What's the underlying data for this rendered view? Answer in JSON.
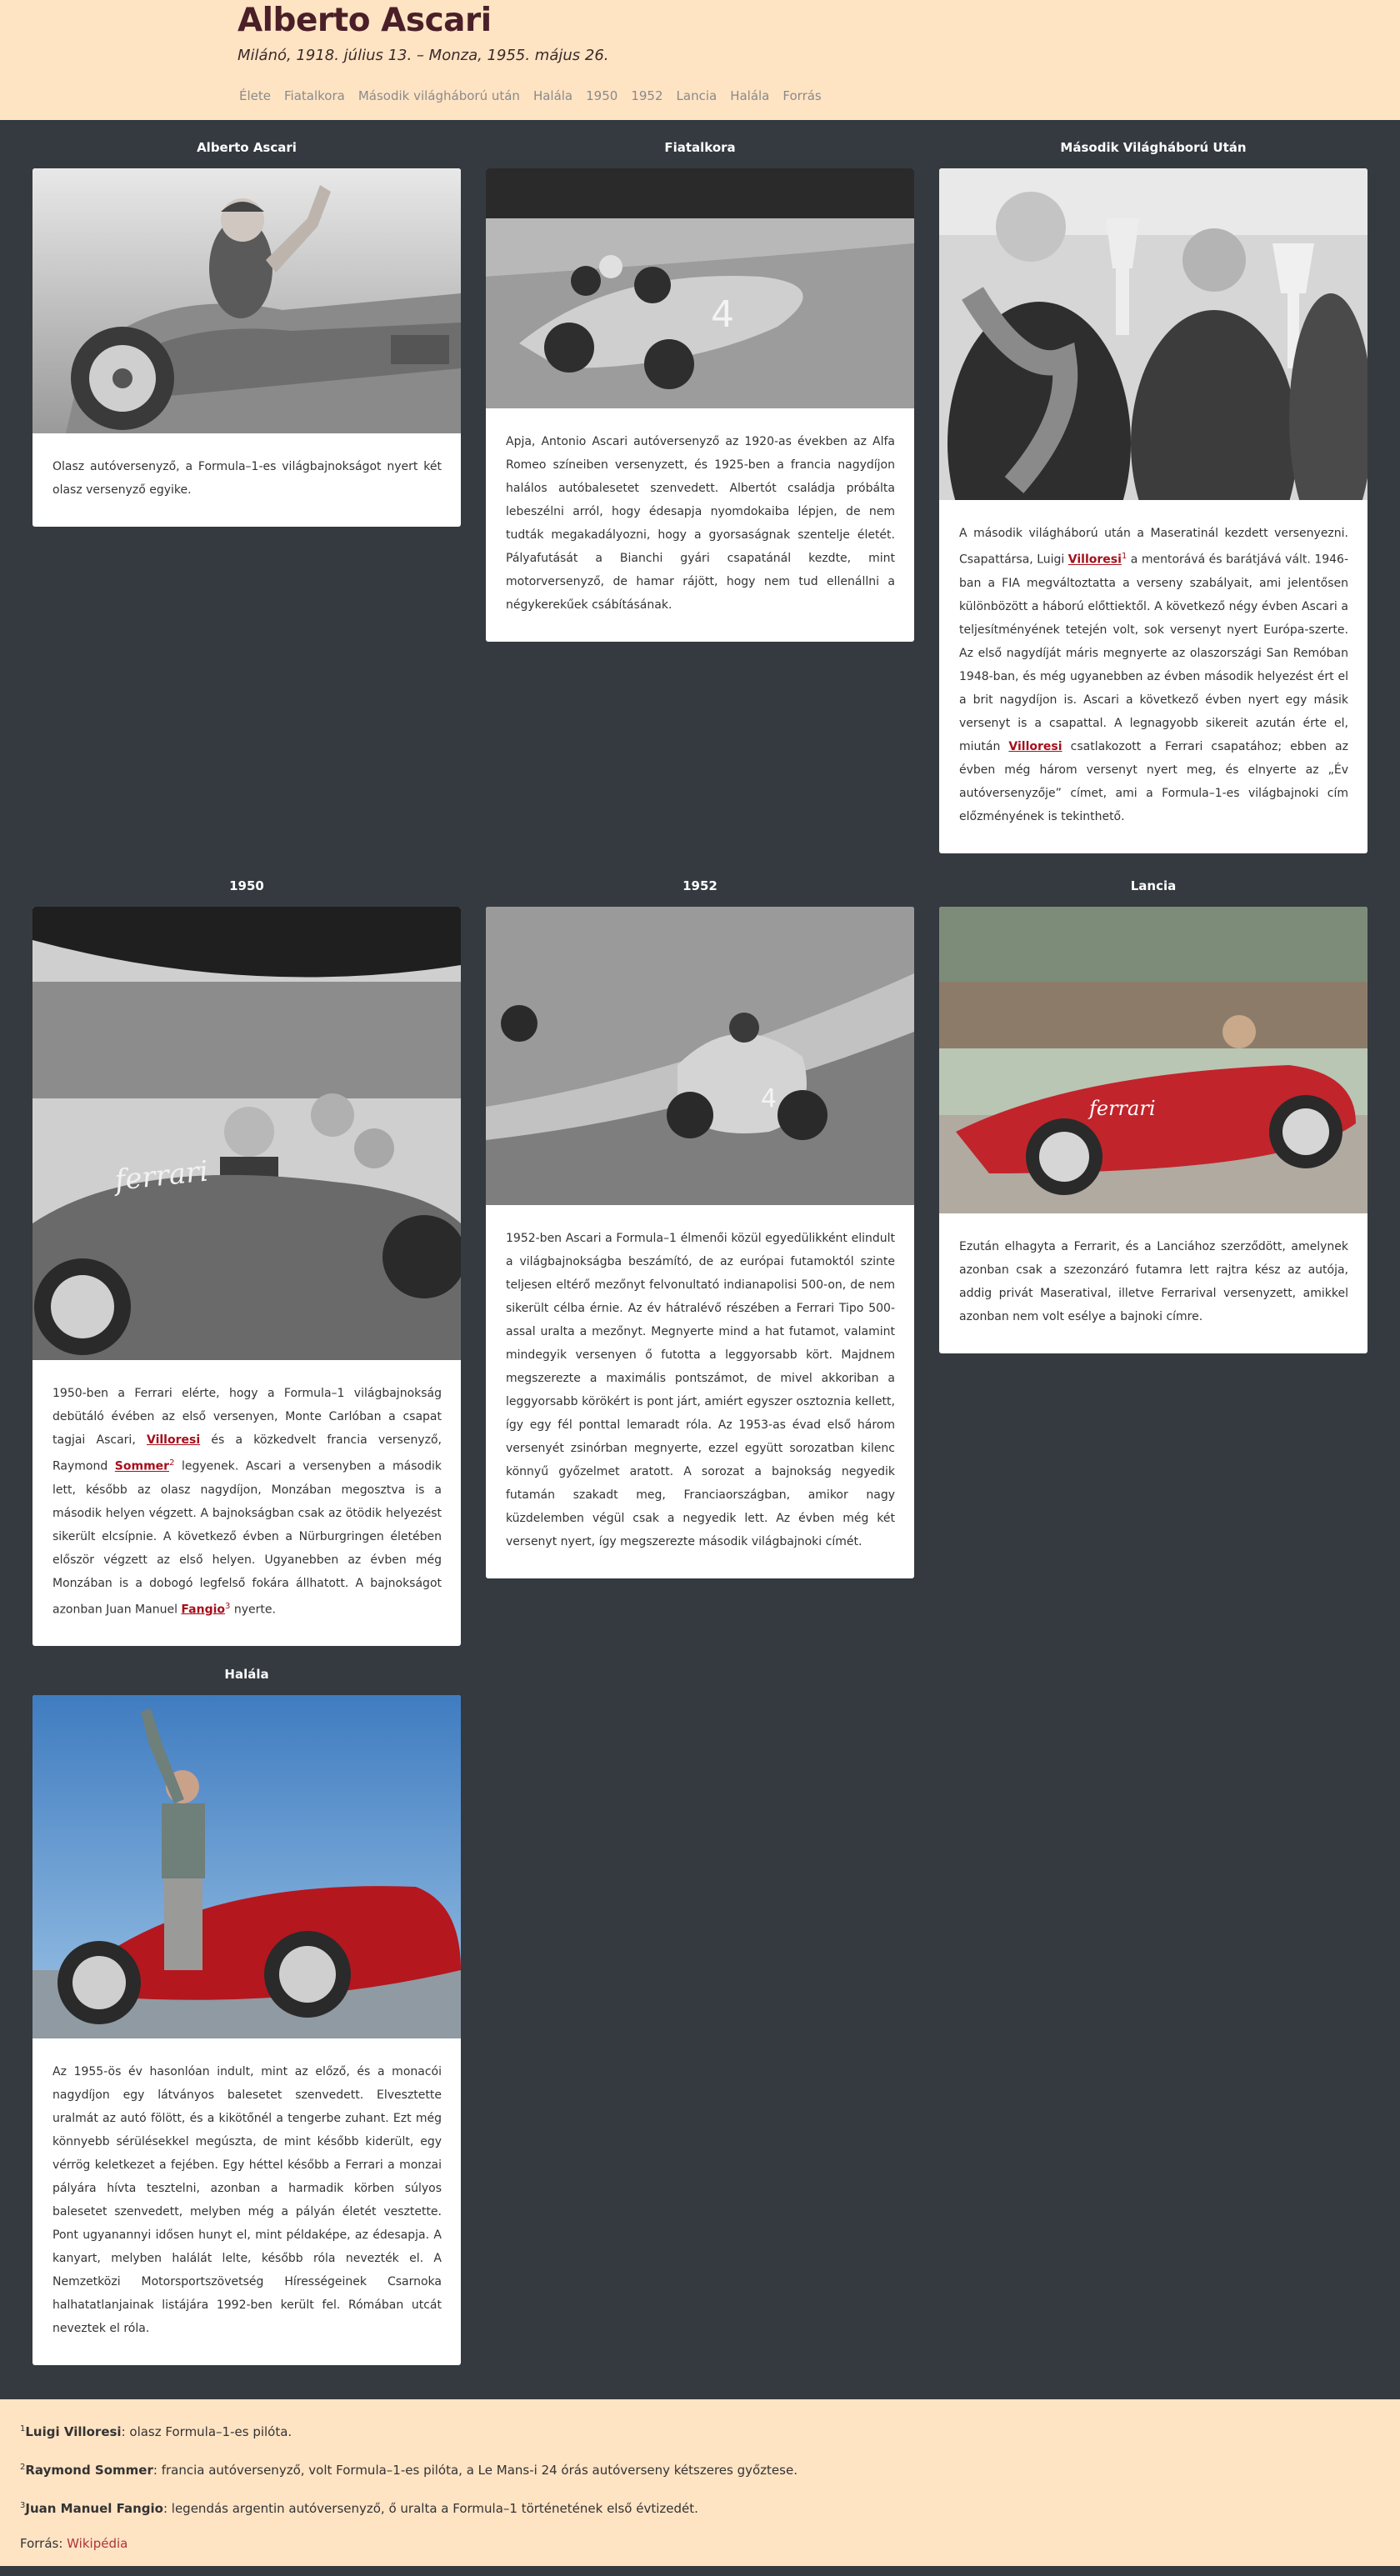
{
  "header": {
    "title": "Alberto Ascari",
    "subtitle": "Milánó, 1918. július 13. – Monza, 1955. május 26.",
    "nav": [
      "Élete",
      "Fiatalkora",
      "Második világháború után",
      "Halála",
      "1950",
      "1952",
      "Lancia",
      "Halála",
      "Forrás"
    ]
  },
  "sections": [
    {
      "title": "Alberto Ascari",
      "text": "Olasz autóversenyző, a Formula–1-es világbajnokságot nyert két olasz versenyző egyike."
    },
    {
      "title": "Fiatalkora",
      "text": "Apja, Antonio Ascari autóversenyző az 1920-as években az Alfa Romeo színeiben versenyzett, és 1925-ben a francia nagydíjon halálos autóbalesetet szenvedett. Albertót családja próbálta lebeszélni arról, hogy édesapja nyomdokaiba lépjen, de nem tudták megakadályozni, hogy a gyorsaságnak szentelje életét. Pályafutását a Bianchi gyári csapatánál kezdte, mint motorversenyző, de hamar rájött, hogy nem tud ellenállni a négykerekűek csábításának."
    },
    {
      "title": "Második Világháború Után",
      "p1": "A második világháború után a Maseratinál kezdett versenyezni. Csapattársa, Luigi ",
      "link1": "Villoresi",
      "sup1": "1",
      "p2": " a mentorává és barátjává vált. 1946-ban a FIA megváltoztatta a verseny szabályait, ami jelentősen különbözött a háború előttiektől. A következő négy évben Ascari a teljesítményének tetején volt, sok versenyt nyert Európa-szerte. Az első nagydíját máris megnyerte az olaszországi San Remóban 1948-ban, és még ugyanebben az évben második helyezést ért el a brit nagydíjon is. Ascari a következő évben nyert egy másik versenyt is a csapattal. A legnagyobb sikereit azután érte el, miután ",
      "link2": "Villoresi",
      "p3": " csatlakozott a Ferrari csapatához; ebben az évben még három versenyt nyert meg, és elnyerte az „Év autóversenyzője” címet, ami a Formula–1-es világbajnoki cím előzményének is tekinthető."
    },
    {
      "title": "1950",
      "p1": "1950-ben a Ferrari elérte, hogy a Formula–1 világbajnokság debütáló évében az első versenyen, Monte Carlóban a csapat tagjai Ascari, ",
      "link1": "Villoresi",
      "p2": " és a közkedvelt francia versenyző, Raymond ",
      "link2": "Sommer",
      "sup2": "2",
      "p3": " legyenek. Ascari a versenyben a második lett, később az olasz nagydíjon, Monzában megosztva is a második helyen végzett. A bajnokságban csak az ötödik helyezést sikerült elcsípnie. A következő évben a Nürburgringen életében először végzett az első helyen. Ugyanebben az évben még Monzában is a dobogó legfelső fokára állhatott. A bajnokságot azonban Juan Manuel ",
      "link3": "Fangio",
      "sup3": "3",
      "p4": " nyerte."
    },
    {
      "title": "1952",
      "text": "1952-ben Ascari a Formula–1 élmenői közül egyedülikként elindult a világbajnokságba beszámító, de az európai futamoktól szinte teljesen eltérő mezőnyt felvonultató indianapolisi 500-on, de nem sikerült célba érnie. Az év hátralévő részében a Ferrari Tipo 500-assal uralta a mezőnyt. Megnyerte mind a hat futamot, valamint mindegyik versenyen ő futotta a leggyorsabb kört. Majdnem megszerezte a maximális pontszámot, de mivel akkoriban a leggyorsabb körökért is pont járt, amiért egyszer osztoznia kellett, így egy fél ponttal lemaradt róla. Az 1953-as évad első három versenyét zsinórban megnyerte, ezzel együtt sorozatban kilenc könnyű győzelmet aratott. A sorozat a bajnokság negyedik futamán szakadt meg, Franciaországban, amikor nagy küzdelemben végül csak a negyedik lett. Az évben még két versenyt nyert, így megszerezte második világbajnoki címét."
    },
    {
      "title": "Lancia",
      "text": "Ezután elhagyta a Ferrarit, és a Lanciához szerződött, amelynek azonban csak a szezonzáró futamra lett rajtra kész az autója, addig privát Maseratival, illetve Ferrarival versenyzett, amikkel azonban nem volt esélye a bajnoki címre."
    },
    {
      "title": "Halála",
      "text": "Az 1955-ös év hasonlóan indult, mint az előző, és a monacói nagydíjon egy látványos balesetet szenvedett. Elvesztette uralmát az autó fölött, és a kikötőnél a tengerbe zuhant. Ezt még könnyebb sérülésekkel megúszta, de mint később kiderült, egy vérrög keletkezet a fejében. Egy héttel később a Ferrari a monzai pályára hívta tesztelni, azonban a harmadik körben súlyos balesetet szenvedett, melyben még a pályán életét vesztette. Pont ugyanannyi idősen hunyt el, mint példaképe, az édesapja. A kanyart, melyben halálát lelte, később róla nevezték el. A Nemzetközi Motorsportszövetség Hírességeinek Csarnoka halhatatlanjainak listájára 1992-ben került fel. Rómában utcát neveztek el róla."
    }
  ],
  "footnotes": [
    {
      "num": "1",
      "name": "Luigi Villoresi",
      "text": ": olasz Formula–1-es pilóta."
    },
    {
      "num": "2",
      "name": "Raymond Sommer",
      "text": ": francia autóversenyző, volt Formula–1-es pilóta, a Le Mans-i 24 órás autóverseny kétszeres győztese."
    },
    {
      "num": "3",
      "name": "Juan Manuel Fangio",
      "text": ": legendás argentin autóversenyző, ő uralta a Formula–1 történetének első évtizedét."
    }
  ],
  "source": {
    "label": "Forrás: ",
    "link": "Wikipédia"
  },
  "colors": {
    "header_bg": "#ffe4c4",
    "page_bg": "#343a40",
    "title": "#4a1f28",
    "link": "#a50f1c"
  },
  "images": [
    "ascari-waving-in-car-photo",
    "ferrari-race-car-on-track-photo",
    "ascari-villoresi-trophies-photo",
    "ascari-ferrari-group-photo",
    "ascari-1952-race-photo",
    "red-ferrari-lancia-photo",
    "ascari-standing-red-car-photo"
  ]
}
